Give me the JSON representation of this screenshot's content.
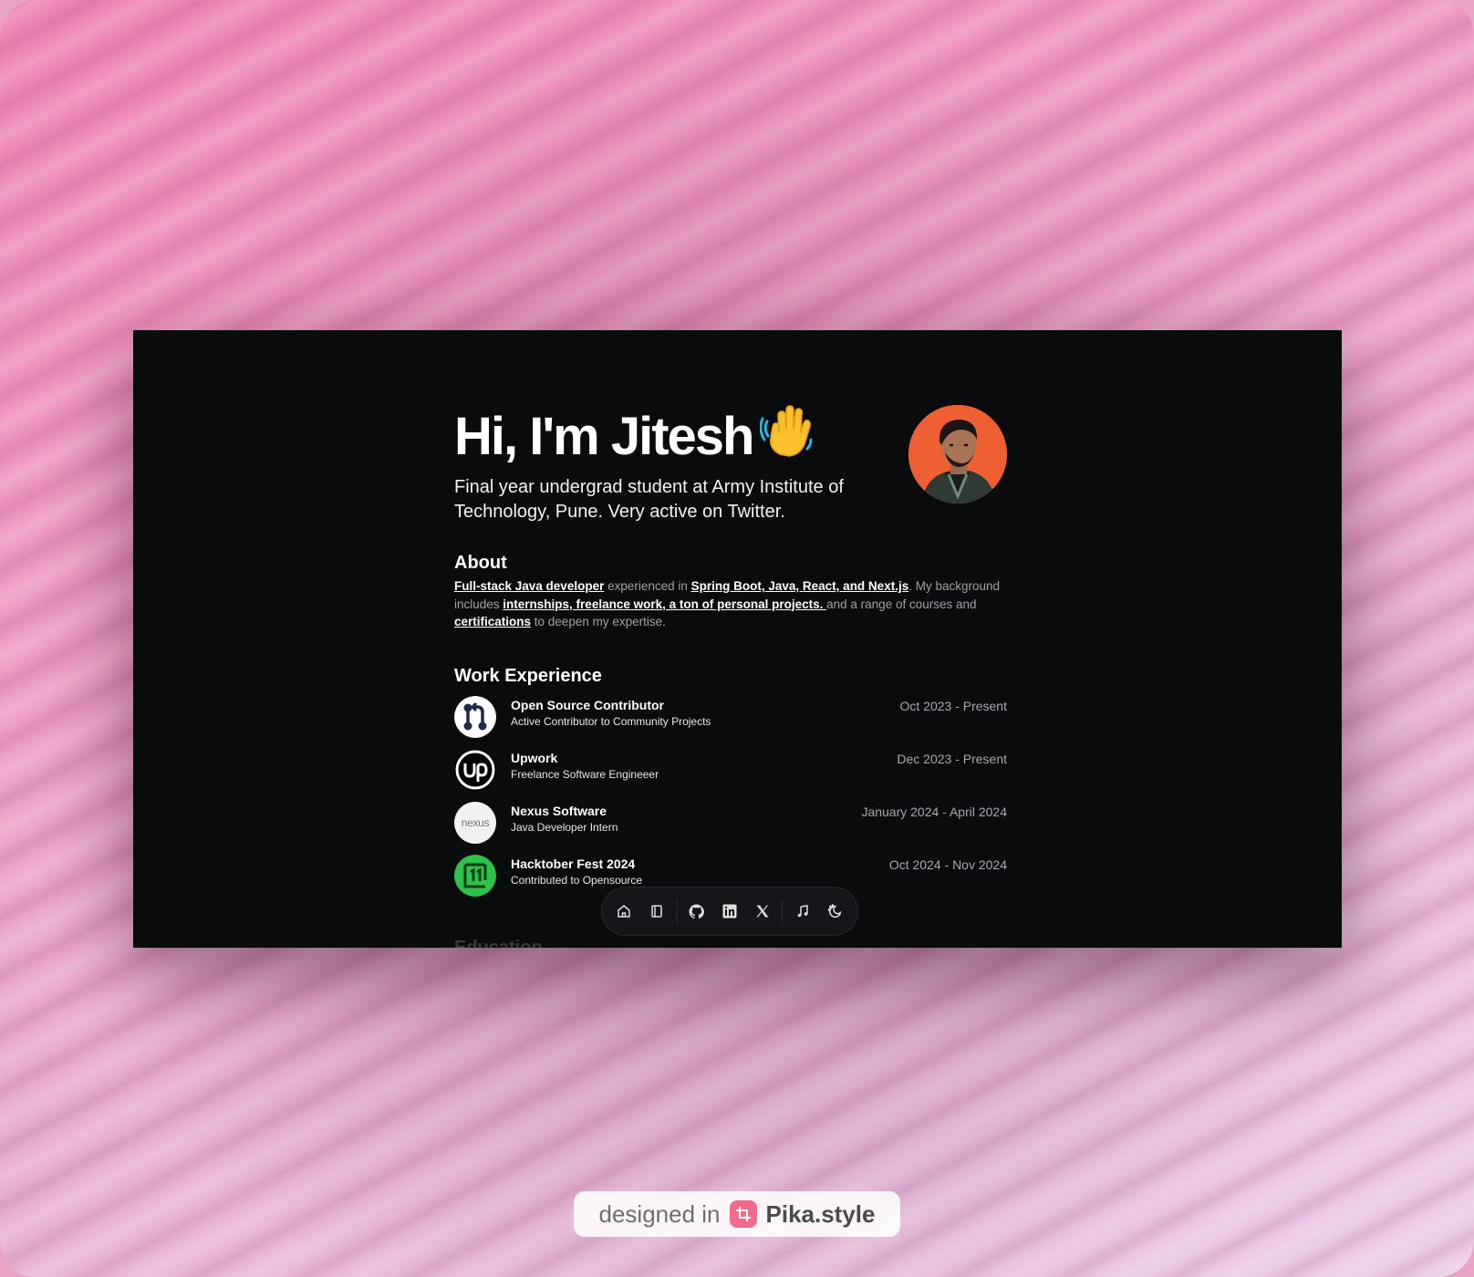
{
  "hero": {
    "greeting": "Hi, I'm Jitesh",
    "emoji": "👋",
    "subtitle": "Final year undergrad student at Army Institute of Technology, Pune. Very active on Twitter."
  },
  "about": {
    "heading": "About",
    "parts": {
      "link1": "Full-stack Java developer",
      "text1": " experienced in ",
      "link2": "Spring Boot, Java, React, and Next.js",
      "text2": ". My background includes ",
      "link3": "internships, freelance work, a ton of personal projects. ",
      "text3": "and a range of courses and ",
      "link4": "certifications",
      "text4": " to deepen my expertise."
    }
  },
  "work": {
    "heading": "Work Experience",
    "jobs": [
      {
        "title": "Open Source Contributor",
        "role": "Active Contributor to Community Projects",
        "dates": "Oct 2023 - Present",
        "logo": "git-merge-icon"
      },
      {
        "title": "Upwork",
        "role": "Freelance Software Engineeer",
        "dates": "Dec 2023 - Present",
        "logo": "upwork-logo"
      },
      {
        "title": "Nexus Software",
        "role": "Java Developer Intern",
        "dates": "January 2024 - April 2024",
        "logo_text": "nexus"
      },
      {
        "title": "Hacktober Fest 2024",
        "role": "Contributed to Opensource",
        "dates": "Oct 2024 - Nov 2024",
        "logo": "hacktoberfest-logo"
      }
    ]
  },
  "education_peek": "Education",
  "dock": {
    "items": [
      "home-icon",
      "notebook-icon",
      "github-icon",
      "linkedin-icon",
      "x-icon",
      "music-icon",
      "theme-toggle-icon"
    ]
  },
  "badge": {
    "prefix": "designed in",
    "brand": "Pika.style"
  },
  "colors": {
    "page_bg": "#0a0b0d",
    "avatar_bg": "#ef5f34",
    "hacktober_green": "#2ec24a",
    "badge_icon": "#f26b8f"
  }
}
